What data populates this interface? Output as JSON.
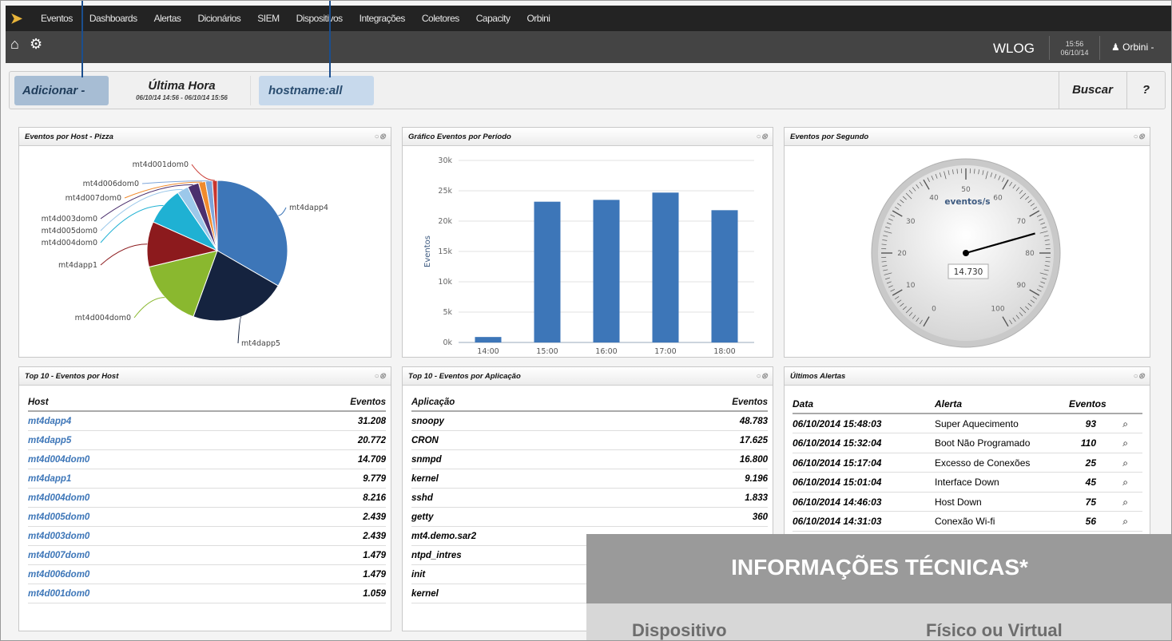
{
  "topnav": {
    "menu": [
      "Eventos",
      "Dashboards",
      "Alertas",
      "Dicionários",
      "SIEM",
      "Dispositivos",
      "Integrações",
      "Coletores",
      "Capacity",
      "Orbini"
    ]
  },
  "subbar": {
    "brand": "WLOG",
    "time": "15:56",
    "date": "06/10/14",
    "user": "Orbini -"
  },
  "searchbar": {
    "add_label": "Adicionar -",
    "time_title": "Última Hora",
    "time_range": "06/10/14 14:56 - 06/10/14 15:56",
    "query": "hostname:all",
    "search_label": "Buscar",
    "help_label": "?"
  },
  "panels": {
    "pie_title": "Eventos por Host - Pizza",
    "bar_title": "Gráfico Eventos por Período",
    "gauge_title": "Eventos por Segundo",
    "top_hosts_title": "Top 10 - Eventos por Host",
    "top_apps_title": "Top 10 - Eventos por Aplicação",
    "alerts_title": "Últimos Alertas"
  },
  "gauge": {
    "unit_label": "eventos/s",
    "value_text": "14.730",
    "value": 14.73,
    "min": 0,
    "max": 100,
    "ticks": [
      "0",
      "10",
      "20",
      "30",
      "40",
      "50",
      "60",
      "70",
      "80",
      "90",
      "100"
    ]
  },
  "chart_data": [
    {
      "type": "pie",
      "labels": [
        "mt4dapp4",
        "mt4dapp5",
        "mt4d004dom0",
        "mt4dapp1",
        "mt4d004dom0",
        "mt4d005dom0",
        "mt4d003dom0",
        "mt4d007dom0",
        "mt4d006dom0",
        "mt4d001dom0"
      ],
      "values": [
        31208,
        20772,
        14709,
        9779,
        8216,
        2439,
        2439,
        1479,
        1479,
        1059
      ],
      "colors": [
        "#3d76b8",
        "#15233f",
        "#8ab82f",
        "#8c1a1d",
        "#1fb1d3",
        "#9cc8ea",
        "#4b2f6e",
        "#f08a2c",
        "#7fa6da",
        "#c8352e"
      ]
    },
    {
      "type": "bar",
      "categories": [
        "14:00",
        "15:00",
        "16:00",
        "17:00",
        "18:00"
      ],
      "values": [
        900,
        23200,
        23500,
        24700,
        21800
      ],
      "ylabel": "Eventos",
      "ylim": [
        0,
        30000
      ],
      "yticks": [
        "0k",
        "5k",
        "10k",
        "15k",
        "20k",
        "25k",
        "30k"
      ],
      "color": "#3d76b8"
    }
  ],
  "top_hosts": {
    "headers": [
      "Host",
      "Eventos"
    ],
    "rows": [
      [
        "mt4dapp4",
        "31.208"
      ],
      [
        "mt4dapp5",
        "20.772"
      ],
      [
        "mt4d004dom0",
        "14.709"
      ],
      [
        "mt4dapp1",
        "9.779"
      ],
      [
        "mt4d004dom0",
        "8.216"
      ],
      [
        "mt4d005dom0",
        "2.439"
      ],
      [
        "mt4d003dom0",
        "2.439"
      ],
      [
        "mt4d007dom0",
        "1.479"
      ],
      [
        "mt4d006dom0",
        "1.479"
      ],
      [
        "mt4d001dom0",
        "1.059"
      ]
    ]
  },
  "top_apps": {
    "headers": [
      "Aplicação",
      "Eventos"
    ],
    "rows": [
      [
        "snoopy",
        "48.783"
      ],
      [
        "CRON",
        "17.625"
      ],
      [
        "snmpd",
        "16.800"
      ],
      [
        "kernel",
        "9.196"
      ],
      [
        "sshd",
        "1.833"
      ],
      [
        "getty",
        "360"
      ],
      [
        "mt4.demo.sar2",
        ""
      ],
      [
        "ntpd_intres",
        ""
      ],
      [
        "init",
        ""
      ],
      [
        "kernel",
        ""
      ]
    ]
  },
  "alerts": {
    "headers": [
      "Data",
      "Alerta",
      "Eventos"
    ],
    "rows": [
      [
        "06/10/2014 15:48:03",
        "Super Aquecimento",
        "93"
      ],
      [
        "06/10/2014 15:32:04",
        "Boot Não Programado",
        "110"
      ],
      [
        "06/10/2014 15:17:04",
        "Excesso de Conexões",
        "25"
      ],
      [
        "06/10/2014 15:01:04",
        "Interface Down",
        "45"
      ],
      [
        "06/10/2014 14:46:03",
        "Host Down",
        "75"
      ],
      [
        "06/10/2014 14:31:03",
        "Conexão Wi-fi",
        "56"
      ]
    ]
  },
  "info_overlay": {
    "title": "INFORMAÇÕES TÉCNICAS*",
    "col1": "Dispositivo",
    "col2": "Físico ou Virtual"
  }
}
